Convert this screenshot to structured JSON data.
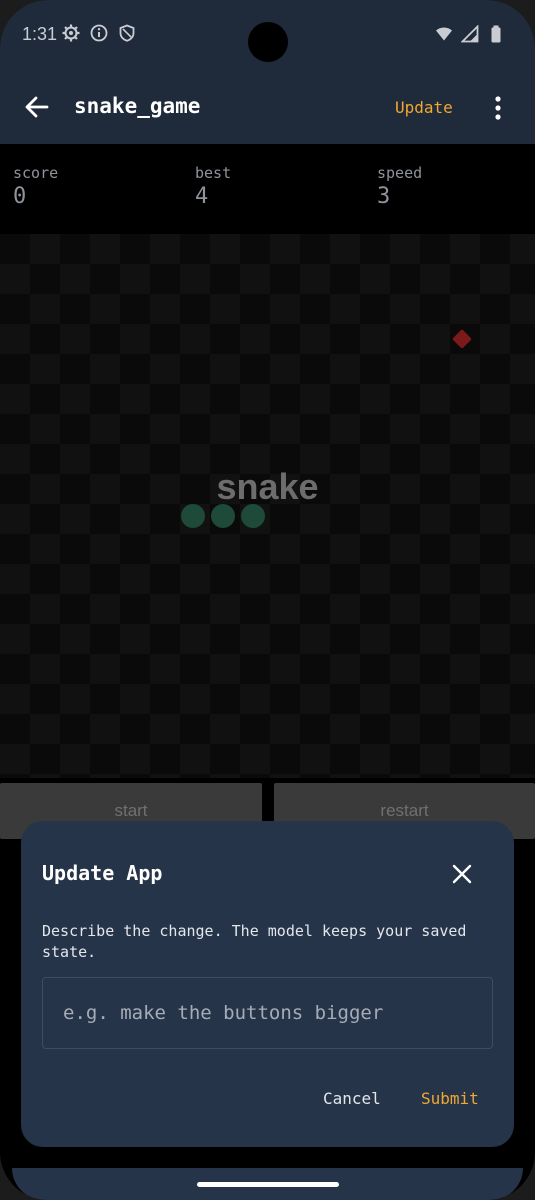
{
  "status_bar": {
    "time": "1:31",
    "left_icons": [
      "gear-icon",
      "info-icon",
      "shield-icon"
    ],
    "right_icons": [
      "wifi-icon",
      "signal-icon",
      "battery-icon"
    ]
  },
  "app_bar": {
    "title": "snake_game",
    "update_label": "Update",
    "accent_color": "#f0a830"
  },
  "stats": [
    {
      "label": "score",
      "value": "0"
    },
    {
      "label": "best",
      "value": "4"
    },
    {
      "label": "speed",
      "value": "3"
    }
  ],
  "board": {
    "title": "snake",
    "snake_color": "#1e4a3a",
    "food_color": "#7a1a1a"
  },
  "controls": {
    "start_label": "start",
    "restart_label": "restart"
  },
  "dialog": {
    "title": "Update App",
    "description": "Describe the change. The model keeps your saved state.",
    "input_placeholder": "e.g. make the buttons bigger",
    "input_value": "",
    "cancel_label": "Cancel",
    "submit_label": "Submit"
  }
}
